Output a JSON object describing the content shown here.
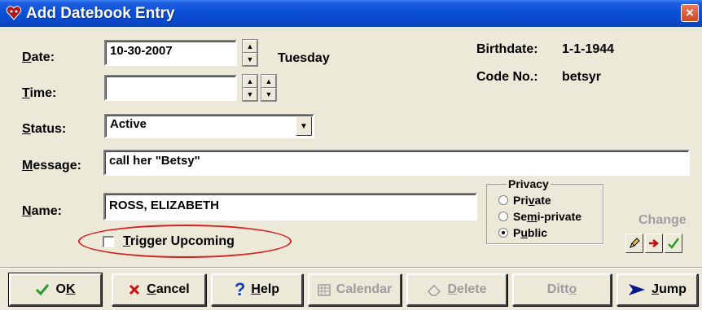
{
  "window": {
    "title": "Add Datebook Entry",
    "close_glyph": "×"
  },
  "fields": {
    "date": {
      "label_pre": "",
      "label_u": "D",
      "label_post": "ate:",
      "value": "10-30-2007",
      "weekday": "Tuesday"
    },
    "time": {
      "label_pre": "",
      "label_u": "T",
      "label_post": "ime:",
      "value": ""
    },
    "status": {
      "label_pre": "",
      "label_u": "S",
      "label_post": "tatus:",
      "value": "Active"
    },
    "message": {
      "label_pre": "",
      "label_u": "M",
      "label_post": "essage:",
      "value": "call her \"Betsy\""
    },
    "name": {
      "label_pre": "",
      "label_u": "N",
      "label_post": "ame:",
      "value": "ROSS, ELIZABETH"
    }
  },
  "info": {
    "birthdate_label": "Birthdate:",
    "birthdate_value": "1-1-1944",
    "code_label": "Code No.:",
    "code_value": "betsyr"
  },
  "privacy": {
    "title": "Privacy",
    "options": [
      {
        "pre": "Pri",
        "u": "v",
        "post": "ate",
        "selected": false
      },
      {
        "pre": "Se",
        "u": "m",
        "post": "i-private",
        "selected": false
      },
      {
        "pre": "P",
        "u": "u",
        "post": "blic",
        "selected": true
      }
    ]
  },
  "trigger": {
    "pre": "",
    "u": "T",
    "post": "rigger Upcoming",
    "checked": false
  },
  "change_label": "Change",
  "buttons": {
    "ok": {
      "pre": "O",
      "u": "K",
      "post": ""
    },
    "cancel": {
      "pre": "",
      "u": "C",
      "post": "ancel"
    },
    "help": {
      "pre": "",
      "u": "H",
      "post": "elp"
    },
    "calendar": {
      "pre": "Calendar",
      "u": "",
      "post": ""
    },
    "delete": {
      "pre": "",
      "u": "D",
      "post": "elete"
    },
    "ditto": {
      "pre": "Ditt",
      "u": "o",
      "post": ""
    },
    "jump": {
      "pre": "",
      "u": "J",
      "post": "ump"
    }
  },
  "colors": {
    "titlebar": "#0a4fd6",
    "highlight_ellipse": "#d42020",
    "ok_check": "#2e9a2e",
    "cancel_x": "#d01010",
    "help_q": "#1040c0",
    "jump_arrow": "#0a1a8a"
  }
}
